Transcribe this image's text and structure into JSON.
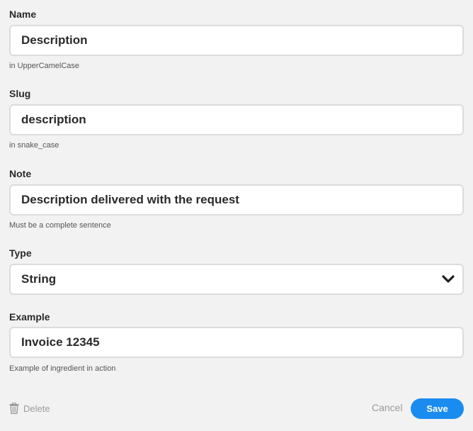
{
  "fields": {
    "name": {
      "label": "Name",
      "value": "Description",
      "hint": "in UpperCamelCase"
    },
    "slug": {
      "label": "Slug",
      "value": "description",
      "hint": "in snake_case"
    },
    "note": {
      "label": "Note",
      "value": "Description delivered with the request",
      "hint": "Must be a complete sentence"
    },
    "type": {
      "label": "Type",
      "value": "String",
      "icon": "chevron-down-icon"
    },
    "example": {
      "label": "Example",
      "value": "Invoice 12345",
      "hint": "Example of ingredient in action"
    }
  },
  "actions": {
    "delete_label": "Delete",
    "delete_icon": "trash-icon",
    "cancel_label": "Cancel",
    "save_label": "Save"
  },
  "colors": {
    "background": "#f2f2f2",
    "accent": "#1a8cf0",
    "muted_text": "#9a9a9a",
    "input_border": "#dcdcdc"
  }
}
